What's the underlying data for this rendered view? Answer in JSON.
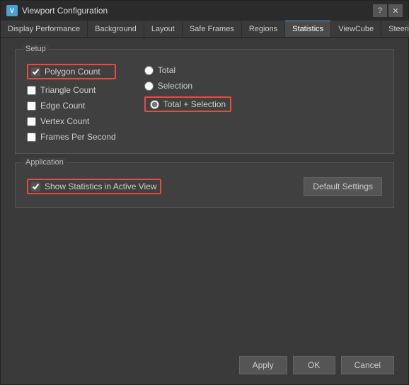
{
  "window": {
    "title": "Viewport Configuration",
    "icon": "V",
    "help_button": "?",
    "close_button": "✕"
  },
  "tabs": [
    {
      "id": "display-performance",
      "label": "Display Performance",
      "active": false
    },
    {
      "id": "background",
      "label": "Background",
      "active": false
    },
    {
      "id": "layout",
      "label": "Layout",
      "active": false
    },
    {
      "id": "safe-frames",
      "label": "Safe Frames",
      "active": false
    },
    {
      "id": "regions",
      "label": "Regions",
      "active": false
    },
    {
      "id": "statistics",
      "label": "Statistics",
      "active": true
    },
    {
      "id": "viewcube",
      "label": "ViewCube",
      "active": false
    },
    {
      "id": "steering-wheels",
      "label": "SteeringWheels",
      "active": false
    }
  ],
  "setup": {
    "label": "Setup",
    "checkboxes": [
      {
        "id": "polygon-count",
        "label": "Polygon Count",
        "checked": true,
        "highlighted": true
      },
      {
        "id": "triangle-count",
        "label": "Triangle Count",
        "checked": false,
        "highlighted": false
      },
      {
        "id": "edge-count",
        "label": "Edge Count",
        "checked": false,
        "highlighted": false
      },
      {
        "id": "vertex-count",
        "label": "Vertex Count",
        "checked": false,
        "highlighted": false
      },
      {
        "id": "frames-per-second",
        "label": "Frames Per Second",
        "checked": false,
        "highlighted": false
      }
    ],
    "radios": [
      {
        "id": "total",
        "label": "Total",
        "checked": false,
        "highlighted": false
      },
      {
        "id": "selection",
        "label": "Selection",
        "checked": false,
        "highlighted": false
      },
      {
        "id": "total-selection",
        "label": "Total + Selection",
        "checked": true,
        "highlighted": true
      }
    ]
  },
  "application": {
    "label": "Application",
    "show_stats_label": "Show Statistics in Active View",
    "show_stats_checked": true,
    "default_settings_label": "Default Settings"
  },
  "buttons": {
    "apply": "Apply",
    "ok": "OK",
    "cancel": "Cancel"
  }
}
